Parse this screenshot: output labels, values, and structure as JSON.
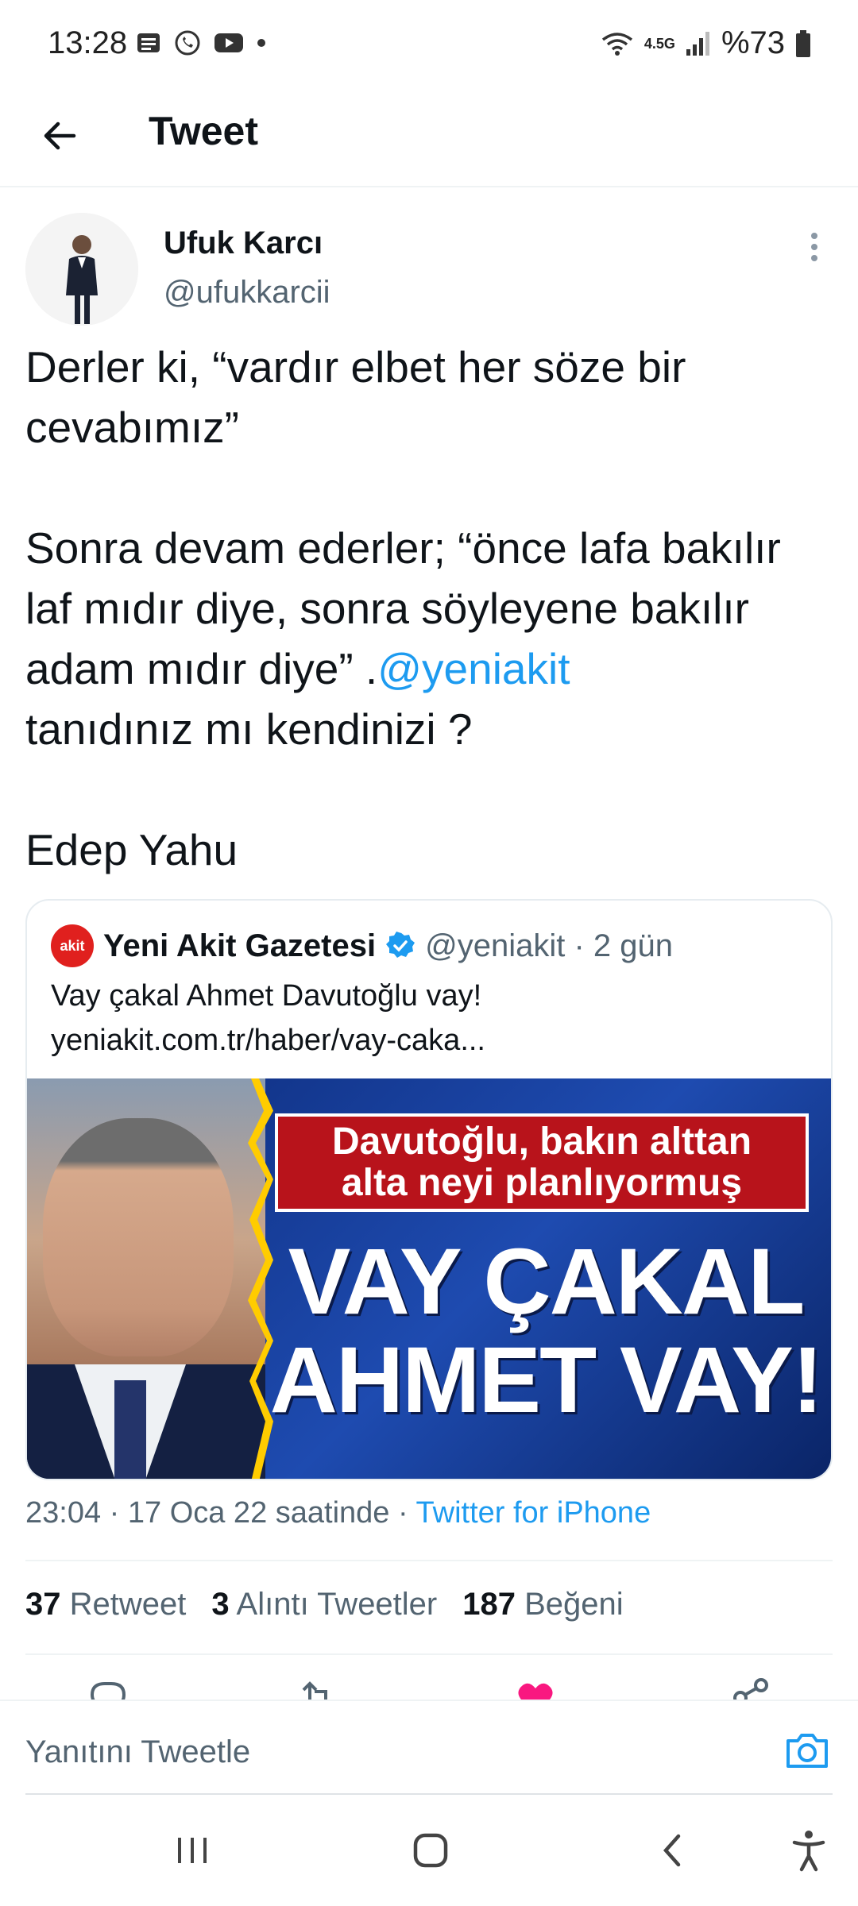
{
  "status_bar": {
    "time": "13:28",
    "network": "4.5G",
    "battery": "%73",
    "left_icons": [
      "notes-icon",
      "whatsapp-icon",
      "youtube-icon",
      "dot-icon"
    ]
  },
  "header": {
    "title": "Tweet"
  },
  "tweet": {
    "author_name": "Ufuk Karcı",
    "author_handle": "@ufukkarcii",
    "text_part1": "Derler ki, “vardır elbet her söze bir cevabımız”\n\nSonra devam ederler; “önce lafa bakılır laf mıdır diye, sonra söyleyene bakılır adam mıdır diye” .",
    "mention": "@yeniakit",
    "text_part2": "\ntanıdınız mı kendinizi ?\n\nEdep Yahu",
    "timestamp": "23:04 · 17 Oca 22 saatinde · ",
    "source": "Twitter for iPhone"
  },
  "quote": {
    "logo_text": "akit",
    "name": "Yeni Akit Gazetesi",
    "handle": "@yeniakit · 2 gün",
    "text": "Vay çakal Ahmet Davutoğlu vay! yeniakit.com.tr/haber/vay-caka...",
    "image": {
      "banner_line1": "Davutoğlu, bakın alttan",
      "banner_line2": "alta neyi planlıyormuş",
      "headline_line1": "VAY ÇAKAL",
      "headline_line2": "AHMET VAY!"
    }
  },
  "stats": {
    "retweets_count": "37",
    "retweets_label": "Retweet",
    "quotes_count": "3",
    "quotes_label": "Alıntı Tweetler",
    "likes_count": "187",
    "likes_label": "Beğeni"
  },
  "reply": {
    "placeholder": "Yanıtını Tweetle"
  },
  "colors": {
    "accent": "#1d9bf0",
    "like": "#f91880",
    "text": "#0f1419",
    "muted": "#536471"
  }
}
